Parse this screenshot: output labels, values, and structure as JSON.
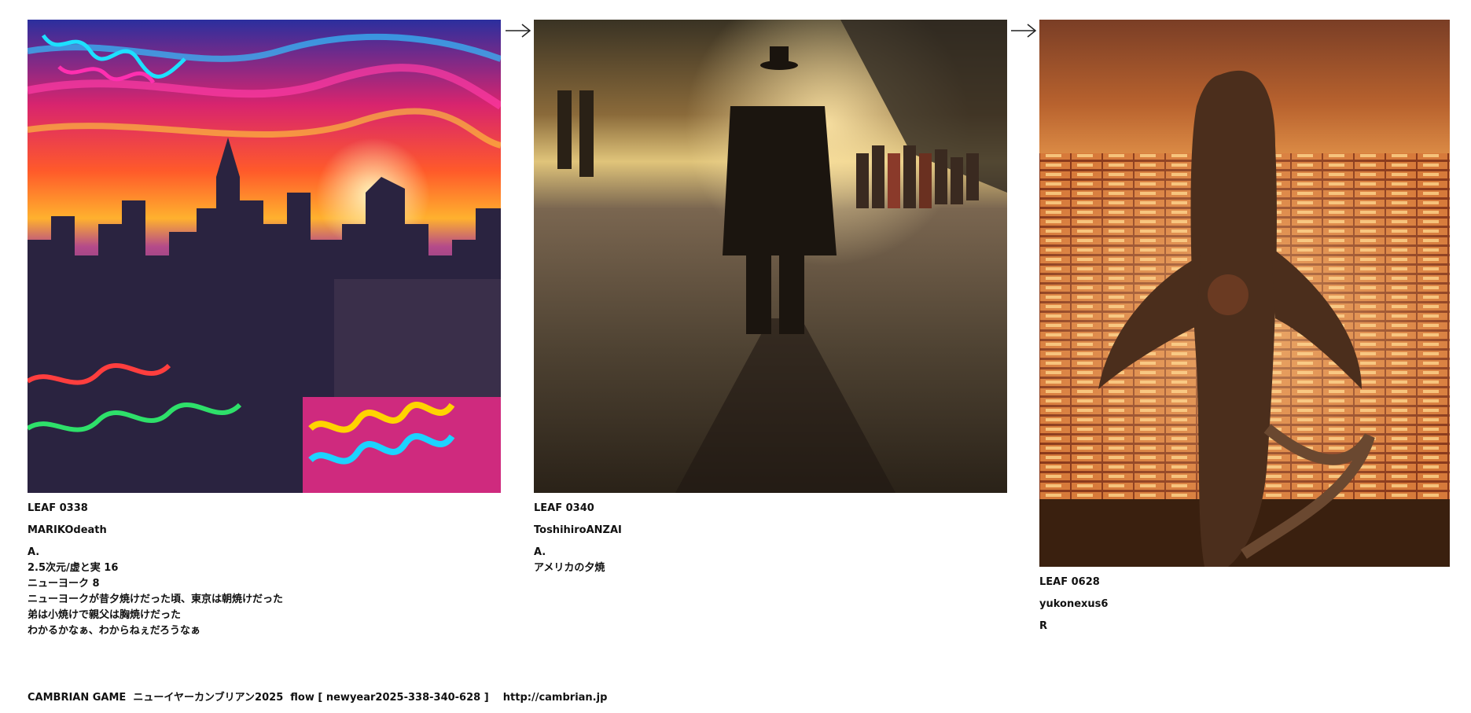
{
  "leaves": [
    {
      "leaf_id": "LEAF 0338",
      "author": "MARIKOdeath",
      "grade": "A.",
      "lines": [
        "2.5次元/虚と実 16",
        "ニューヨーク 8",
        "ニューヨークが昔夕焼けだった頃、東京は朝焼けだった",
        "弟は小焼けで親父は胸焼けだった",
        "わかるかなぁ、わからねぇだろうなぁ"
      ]
    },
    {
      "leaf_id": "LEAF 0340",
      "author": "ToshihiroANZAI",
      "grade": "A.",
      "lines": [
        "アメリカの夕焼"
      ]
    },
    {
      "leaf_id": "LEAF 0628",
      "author": "yukonexus6",
      "grade": "R",
      "lines": []
    }
  ],
  "arrow_icon": "right-arrow-icon",
  "footer": "CAMBRIAN GAME  ニューイヤーカンブリアン2025  flow [ newyear2025-338-340-628 ]    http://cambrian.jp"
}
